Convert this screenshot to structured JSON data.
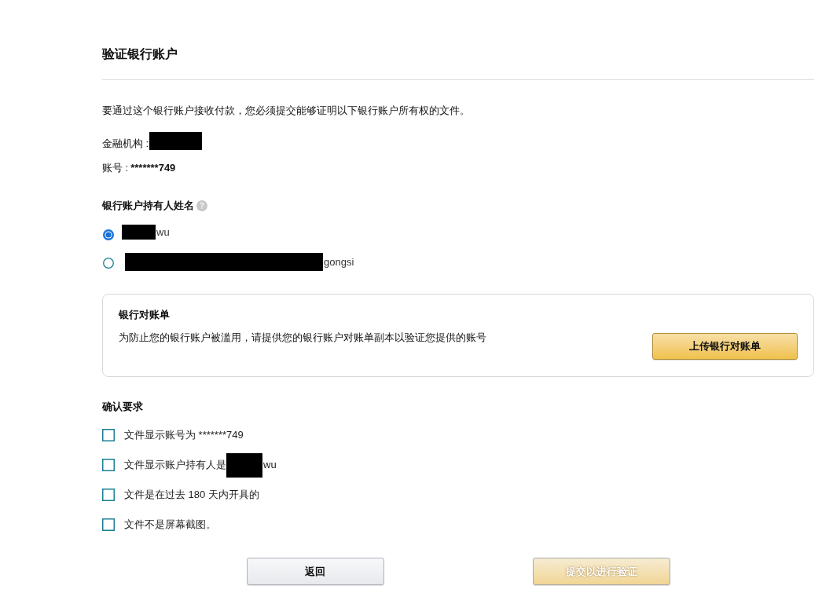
{
  "title": "验证银行账户",
  "intro": "要通过这个银行账户接收付款，您必须提交能够证明以下银行账户所有权的文件。",
  "details": [
    {
      "label": "金融机构 :",
      "redacted": true
    },
    {
      "label": "账号 :",
      "redacted": false,
      "value": "*******749"
    }
  ],
  "holder_name": {
    "heading": "银行账户持有人姓名",
    "options": [
      {
        "redacted": true,
        "text": "wu",
        "selected": true
      },
      {
        "redacted": true,
        "text": "gongsi",
        "selected": false
      }
    ]
  },
  "statement_card": {
    "heading": "银行对账单",
    "description": "为防止您的银行账户被滥用，请提供您的银行账户对账单副本以验证您提供的账号",
    "button": "上传银行对账单"
  },
  "requirements": {
    "heading": "确认要求",
    "items": [
      {
        "text": "文件显示账号为 *******749",
        "redacted": false,
        "checked": false
      },
      {
        "text": "文件显示账户持有人是",
        "redacted": true,
        "suffix": "wu",
        "checked": false
      },
      {
        "text": "文件是在过去 180 天内开具的",
        "redacted": false,
        "checked": false
      },
      {
        "text": "文件不是屏幕截图。",
        "redacted": false,
        "checked": false
      }
    ]
  },
  "buttons": [
    {
      "label": "返回",
      "kind": "secondary",
      "disabled": false
    },
    {
      "label": "提交以进行验证",
      "kind": "primary",
      "disabled": true
    }
  ]
}
